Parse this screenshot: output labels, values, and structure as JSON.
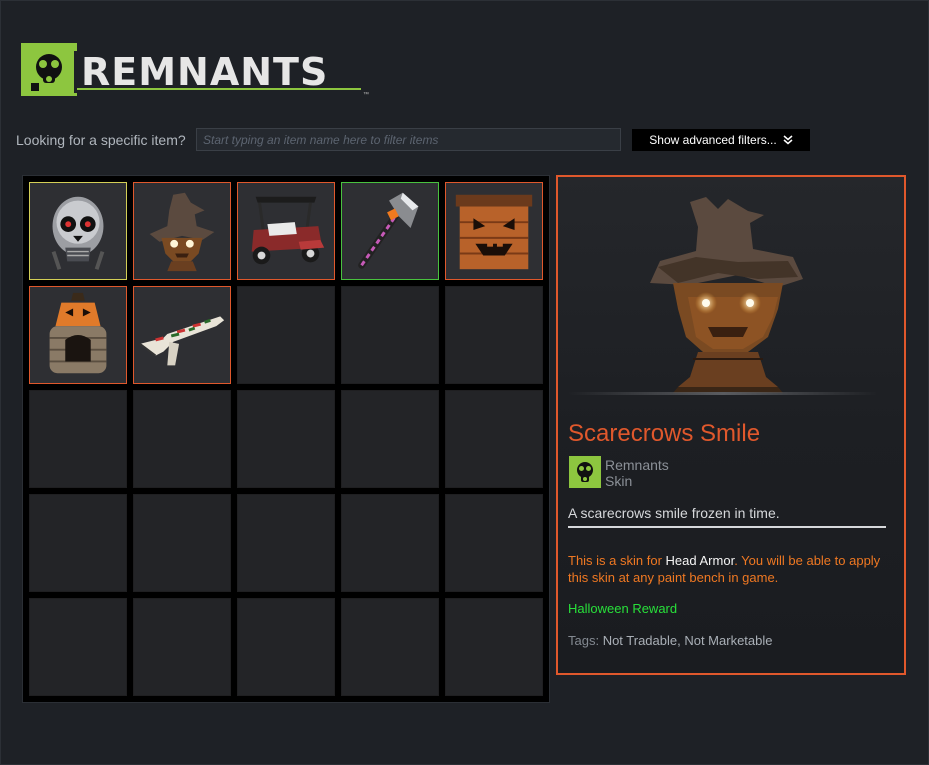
{
  "app": {
    "logo_text": "REMNANTS",
    "logo_tm": "™"
  },
  "filter": {
    "label": "Looking for a specific item?",
    "placeholder": "Start typing an item name here to filter items",
    "value": "",
    "advanced_button": "Show advanced filters..."
  },
  "colors": {
    "accent": "#e0582c",
    "logo_green": "#8dc63f",
    "rarity_yellow": "#d4cf56",
    "rarity_green": "#49c23f",
    "rarity_orange": "#e0582c",
    "reward_green": "#28e03a",
    "note_orange": "#ef7822"
  },
  "inventory": {
    "items": [
      {
        "name": "Skull Mask",
        "icon": "skull-mask-icon",
        "border": "#d4cf56"
      },
      {
        "name": "Scarecrows Smile",
        "icon": "scarecrow-head-icon",
        "border": "#e0582c",
        "selected": true
      },
      {
        "name": "Golf Cart",
        "icon": "golf-cart-icon",
        "border": "#e0582c"
      },
      {
        "name": "Halloween Axe",
        "icon": "axe-icon",
        "border": "#49c23f"
      },
      {
        "name": "Pumpkin Crate",
        "icon": "pumpkin-crate-icon",
        "border": "#e0582c"
      },
      {
        "name": "Pumpkin Furnace",
        "icon": "pumpkin-furnace-icon",
        "border": "#e0582c"
      },
      {
        "name": "Halloween Rifle",
        "icon": "rifle-icon",
        "border": "#e0582c"
      }
    ],
    "total_slots": 25
  },
  "detail": {
    "name": "Scarecrows Smile",
    "game": "Remnants",
    "type": "Skin",
    "description": "A scarecrows smile frozen in time.",
    "note_prefix": "This is a skin for ",
    "note_item": "Head Armor",
    "note_suffix": ". You will be able to apply this skin at any paint bench in game.",
    "reward": "Halloween Reward",
    "tags_label": "Tags: ",
    "tags_value": "Not Tradable, Not Marketable"
  }
}
